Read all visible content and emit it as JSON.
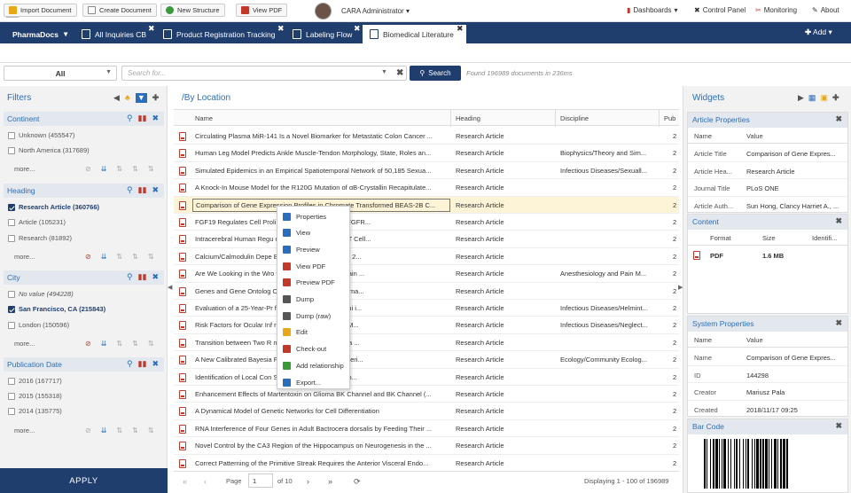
{
  "app": {
    "logo_text": "cara",
    "user": "CARA Administrator"
  },
  "topnav": [
    {
      "label": "Dashboards",
      "icon": "bar-chart-icon",
      "caret": true
    },
    {
      "label": "Control Panel",
      "icon": "wrench-icon"
    },
    {
      "label": "Monitoring",
      "icon": "tools-icon"
    },
    {
      "label": "About",
      "icon": "pen-icon"
    }
  ],
  "tabs": {
    "root": "PharmaDocs",
    "items": [
      {
        "label": "All Inquiries CB"
      },
      {
        "label": "Product Registration Tracking"
      },
      {
        "label": "Labeling Flow"
      },
      {
        "label": "Biomedical Literature",
        "active": true
      }
    ],
    "add_label": "Add"
  },
  "toolbar": {
    "import": "Import Document",
    "create": "Create Document",
    "structure": "New Structure",
    "viewpdf": "View PDF"
  },
  "search": {
    "scope": "All",
    "placeholder": "Search for...",
    "button": "Search",
    "found": "Found 196989 documents in 236ms"
  },
  "filters": {
    "title": "Filters",
    "sections": [
      {
        "name": "Continent",
        "items": [
          {
            "label": "Unknown (455547)",
            "checked": false
          },
          {
            "label": "North America (317689)",
            "checked": false
          }
        ],
        "more": "more..."
      },
      {
        "name": "Heading",
        "items": [
          {
            "label": "Research Article (360766)",
            "checked": true
          },
          {
            "label": "Article (105231)",
            "checked": false
          },
          {
            "label": "Research (81892)",
            "checked": false
          }
        ],
        "more": "more..."
      },
      {
        "name": "City",
        "items": [
          {
            "label": "No value (494228)",
            "checked": false,
            "italic": true
          },
          {
            "label": "San Francisco, CA (215843)",
            "checked": true
          },
          {
            "label": "London (150596)",
            "checked": false
          }
        ],
        "more": "more..."
      },
      {
        "name": "Publication Date",
        "items": [
          {
            "label": "2016 (167717)",
            "checked": false
          },
          {
            "label": "2015 (155318)",
            "checked": false
          },
          {
            "label": "2014 (135775)",
            "checked": false
          }
        ],
        "more": "more..."
      }
    ],
    "apply": "APPLY"
  },
  "list": {
    "title": "/By Location",
    "columns": [
      "Name",
      "Heading",
      "Discipline",
      "Pub"
    ],
    "rows": [
      {
        "name": "Circulating Plasma MiR-141 Is a Novel Biomarker for Metastatic Colon Cancer ...",
        "heading": "Research Article",
        "discipline": "",
        "pub": "2"
      },
      {
        "name": "Human Leg Model Predicts Ankle Muscle-Tendon Morphology, State, Roles an...",
        "heading": "Research Article",
        "discipline": "Biophysics/Theory and Sim...",
        "pub": "2"
      },
      {
        "name": "Simulated Epidemics in an Empirical Spatiotemporal Network of 50,185 Sexua...",
        "heading": "Research Article",
        "discipline": "Infectious Diseases/Sexuall...",
        "pub": "2"
      },
      {
        "name": "A Knock-In Mouse Model for the R120G Mutation of αB-Crystallin Recapitulate...",
        "heading": "Research Article",
        "discipline": "",
        "pub": "2"
      },
      {
        "name": "Comparison of Gene Expression Profiles in Chromate Transformed BEAS-2B C...",
        "heading": "Research Article",
        "discipline": "",
        "pub": "2",
        "highlight": true
      },
      {
        "name": "FGF19 Regulates Cell Proli          ile Acid Metabolism via FGFR...",
        "heading": "Research Article",
        "discipline": "",
        "pub": "2"
      },
      {
        "name": "Intracerebral Human Regu          of CD4+CD25+FOXP3+ T Cell...",
        "heading": "Research Article",
        "discipline": "",
        "pub": "2"
      },
      {
        "name": "Calcium/Calmodulin Depe          Bound to NMDA Receptor 2...",
        "heading": "Research Article",
        "discipline": "",
        "pub": "2"
      },
      {
        "name": "Are We Looking in the Wro          for Behavioural-Based Pain ...",
        "heading": "Research Article",
        "discipline": "Anesthesiology and Pain M...",
        "pub": "2"
      },
      {
        "name": "Genes and Gene Ontolog          Obstruction and Emphysema...",
        "heading": "Research Article",
        "discipline": "",
        "pub": "2"
      },
      {
        "name": "Evaluation of a 25-Year-Pr          f Schistosomiasis Mansoni i...",
        "heading": "Research Article",
        "discipline": "Infectious Diseases/Helmint...",
        "pub": "2"
      },
      {
        "name": "Risk Factors for Ocular Inf          rachomatis in Children 6 M...",
        "heading": "Research Article",
        "discipline": "Infectious Diseases/Neglect...",
        "pub": "2"
      },
      {
        "name": "Transition between Two R          nal Fluctuation of DNA in a ...",
        "heading": "Research Article",
        "discipline": "",
        "pub": "2"
      },
      {
        "name": "A New Calibrated Bayesia          Fit Method: Sampled Posteri...",
        "heading": "Research Article",
        "discipline": "Ecology/Community Ecolog...",
        "pub": "2"
      },
      {
        "name": "Identification of Local Con          Structurally Variable Regio...",
        "heading": "Research Article",
        "discipline": "",
        "pub": "2"
      },
      {
        "name": "Enhancement Effects of Martentoxin on Glioma BK Channel and BK Channel (...",
        "heading": "Research Article",
        "discipline": "",
        "pub": "2"
      },
      {
        "name": "A Dynamical Model of Genetic Networks for Cell Differentiation",
        "heading": "Research Article",
        "discipline": "",
        "pub": "2"
      },
      {
        "name": "RNA Interference of Four Genes in Adult Bactrocera dorsalis by Feeding Their ...",
        "heading": "Research Article",
        "discipline": "",
        "pub": "2"
      },
      {
        "name": "Novel Control by the CA3 Region of the Hippocampus on Neurogenesis in the ...",
        "heading": "Research Article",
        "discipline": "",
        "pub": "2"
      },
      {
        "name": "Correct Patterning of the Primitive Streak Requires the Anterior Visceral Endo...",
        "heading": "Research Article",
        "discipline": "",
        "pub": "2"
      }
    ]
  },
  "context_menu": [
    {
      "label": "Properties",
      "icon": "properties-icon",
      "color": "#2a6ebb"
    },
    {
      "label": "View",
      "icon": "view-icon",
      "color": "#2a6ebb"
    },
    {
      "label": "Preview",
      "icon": "preview-icon",
      "color": "#2a6ebb"
    },
    {
      "label": "View PDF",
      "icon": "view-pdf-icon",
      "color": "#c0392b"
    },
    {
      "label": "Preview PDF",
      "icon": "preview-pdf-icon",
      "color": "#c0392b"
    },
    {
      "label": "Dump",
      "icon": "dump-icon",
      "color": "#555"
    },
    {
      "label": "Dump (raw)",
      "icon": "dump-raw-icon",
      "color": "#555"
    },
    {
      "label": "Edit",
      "icon": "edit-icon",
      "color": "#e6a817"
    },
    {
      "label": "Check-out",
      "icon": "checkout-icon",
      "color": "#c0392b"
    },
    {
      "label": "Add relationship",
      "icon": "relationship-icon",
      "color": "#3a9a3a"
    },
    {
      "label": "Export...",
      "icon": "export-icon",
      "color": "#2a6ebb"
    }
  ],
  "pager": {
    "page_label": "Page",
    "page": "1",
    "of": "of 10",
    "displaying": "Displaying 1 - 100 of 196989"
  },
  "widgets": {
    "title": "Widgets",
    "article": {
      "title": "Article Properties",
      "cols": [
        "Name",
        "Value"
      ],
      "rows": [
        {
          "k": "Article Title",
          "v": "Comparison of Gene Expres..."
        },
        {
          "k": "Article Hea...",
          "v": "Research Article"
        },
        {
          "k": "Journal Title",
          "v": "PLoS ONE"
        },
        {
          "k": "Article Auth...",
          "v": "Sun Hong, Clancy Harriet A., ..."
        }
      ]
    },
    "content": {
      "title": "Content",
      "cols": [
        "Format",
        "Size",
        "Identifi..."
      ],
      "rows": [
        {
          "format": "PDF",
          "size": "1.6 MB"
        }
      ]
    },
    "system": {
      "title": "System Properties",
      "cols": [
        "Name",
        "Value"
      ],
      "rows": [
        {
          "k": "Name",
          "v": "Comparison of Gene Expres..."
        },
        {
          "k": "ID",
          "v": "144298"
        },
        {
          "k": "Creator",
          "v": "Mariusz Pala"
        },
        {
          "k": "Created",
          "v": "2018/11/17 09:25"
        }
      ]
    },
    "barcode": {
      "title": "Bar Code"
    }
  },
  "colors": {
    "navy": "#1f3e6e",
    "link": "#2a6ebb",
    "highlight": "#fdf3d6"
  }
}
